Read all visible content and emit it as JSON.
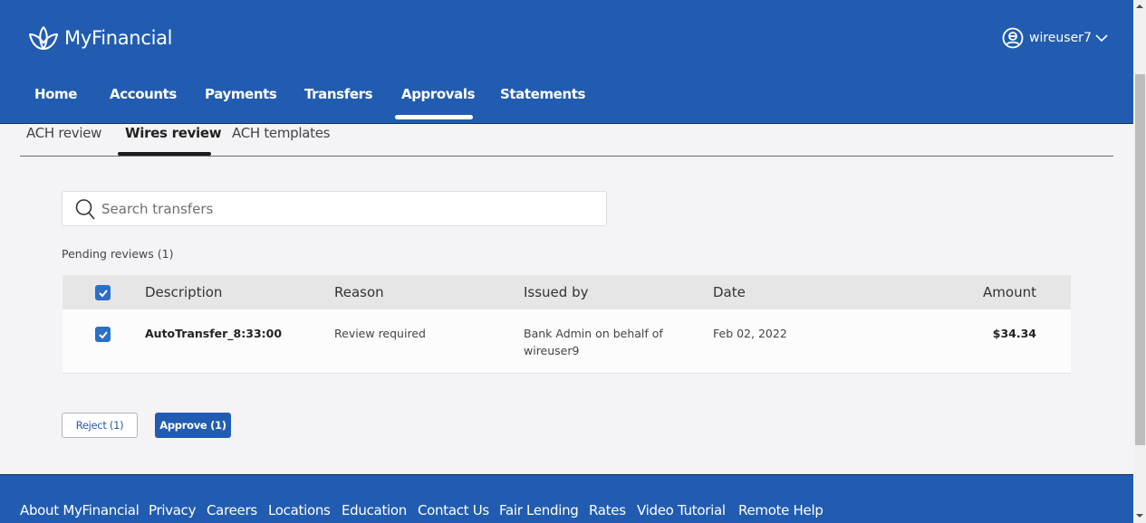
{
  "app": {
    "brand": "MyFinancial",
    "brand_icon": "lotus-logo-icon",
    "colors": {
      "brand": "#215cb0",
      "checkbox": "#2b6fc7"
    }
  },
  "user": {
    "name": "wireuser7",
    "icon": "user-avatar-icon"
  },
  "nav": {
    "items": [
      {
        "label": "Home"
      },
      {
        "label": "Accounts"
      },
      {
        "label": "Payments"
      },
      {
        "label": "Transfers"
      },
      {
        "label": "Approvals",
        "active": true
      },
      {
        "label": "Statements"
      }
    ]
  },
  "subtabs": {
    "items": [
      {
        "label": "ACH review"
      },
      {
        "label": "Wires review",
        "active": true
      },
      {
        "label": "ACH templates"
      }
    ]
  },
  "search": {
    "placeholder": "Search transfers",
    "value": ""
  },
  "pending": {
    "label": "Pending reviews (1)"
  },
  "table": {
    "columns": [
      "Description",
      "Reason",
      "Issued by",
      "Date",
      "Amount"
    ],
    "select_all_checked": true,
    "rows": [
      {
        "checked": true,
        "description": "AutoTransfer_8:33:00",
        "reason": "Review required",
        "issued_by_line1": "Bank Admin on behalf of",
        "issued_by_line2": "wireuser9",
        "date": "Feb 02, 2022",
        "amount": "$34.34"
      }
    ]
  },
  "actions": {
    "reject_label": "Reject (1)",
    "approve_label": "Approve (1)"
  },
  "footer": {
    "links": [
      {
        "label": "About MyFinancial"
      },
      {
        "label": "Privacy"
      },
      {
        "label": "Careers"
      },
      {
        "label": "Locations"
      },
      {
        "label": "Education"
      },
      {
        "label": "Contact Us"
      },
      {
        "label": "Fair Lending"
      },
      {
        "label": "Rates"
      },
      {
        "label": "Video Tutorial"
      },
      {
        "label": "Remote Help"
      }
    ]
  }
}
